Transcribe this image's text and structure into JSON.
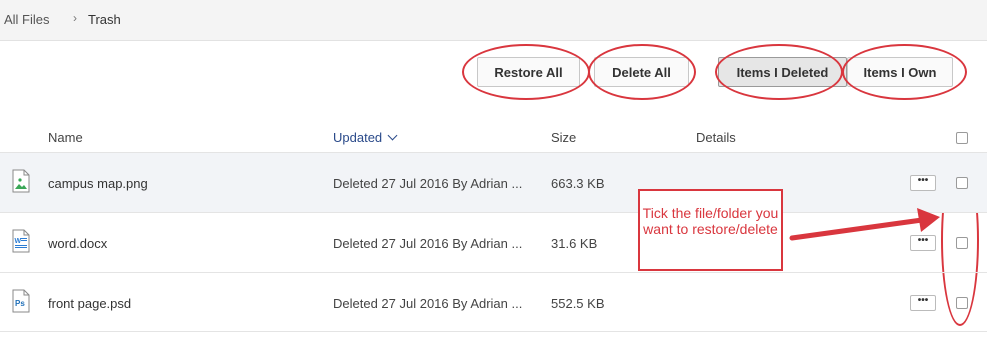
{
  "breadcrumb": {
    "root": "All Files",
    "separator": "›",
    "current": "Trash"
  },
  "toolbar": {
    "restore_all": "Restore All",
    "delete_all": "Delete All",
    "items_i_deleted": "Items I Deleted",
    "items_i_own": "Items I Own"
  },
  "table": {
    "columns": {
      "name": "Name",
      "updated": "Updated",
      "size": "Size",
      "details": "Details"
    },
    "rows": [
      {
        "name": "campus map.png",
        "updated": "Deleted 27 Jul 2016 By Adrian ...",
        "size": "663.3 KB",
        "icon": "image-file-icon",
        "more": "•••"
      },
      {
        "name": "word.docx",
        "updated": "Deleted 27 Jul 2016 By Adrian ...",
        "size": "31.6 KB",
        "icon": "word-file-icon",
        "more": "•••"
      },
      {
        "name": "front page.psd",
        "updated": "Deleted 27 Jul 2016 By Adrian ...",
        "size": "552.5 KB",
        "icon": "photoshop-file-icon",
        "more": "•••"
      }
    ]
  },
  "annotation": {
    "callout_text": "Tick the file/folder you want to restore/delete",
    "color": "#d9363e"
  },
  "icons": {
    "word_badge": "W",
    "psd_badge": "Ps"
  },
  "colors": {
    "accent_link": "#2a4a8a",
    "annotation_red": "#d9363e",
    "image_icon_green": "#3aa757",
    "word_icon_blue": "#2b7cd3",
    "psd_icon_blue": "#1f6fb8"
  }
}
